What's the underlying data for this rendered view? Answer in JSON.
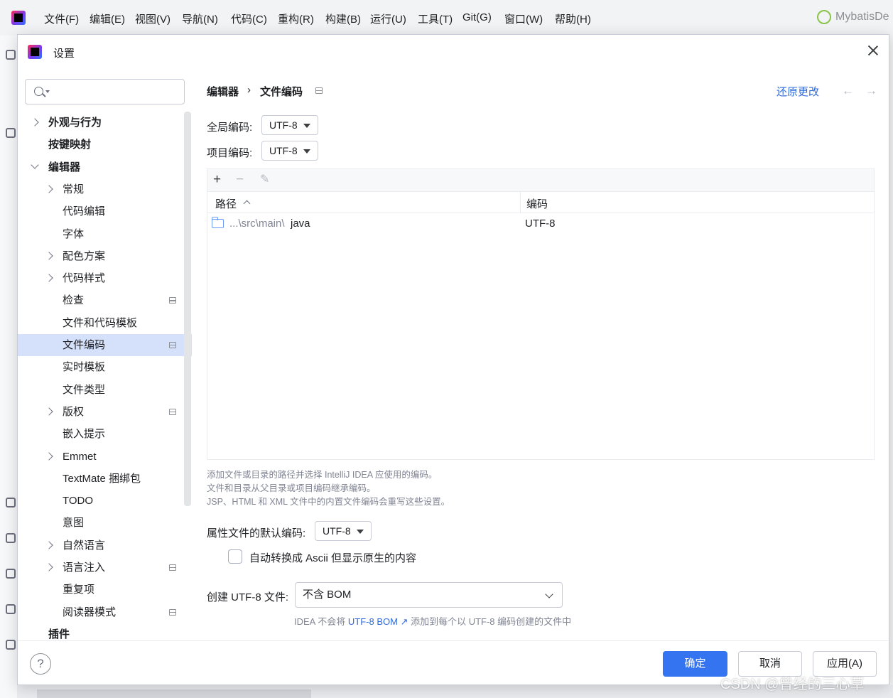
{
  "menubar": {
    "items": [
      "文件(F)",
      "编辑(E)",
      "视图(V)",
      "导航(N)",
      "代码(C)",
      "重构(R)",
      "构建(B)",
      "运行(U)",
      "工具(T)",
      "Git(G)",
      "窗口(W)",
      "帮助(H)"
    ],
    "project": "MybatisDe"
  },
  "dialog": {
    "title": "设置",
    "search": {
      "placeholder": ""
    },
    "tree": [
      {
        "label": "外观与行为",
        "level": 0,
        "bold": true,
        "chevron": "right",
        "scope": false,
        "selected": false
      },
      {
        "label": "按键映射",
        "level": 0,
        "bold": true,
        "chevron": "none",
        "scope": false,
        "selected": false
      },
      {
        "label": "编辑器",
        "level": 0,
        "bold": true,
        "chevron": "down",
        "scope": false,
        "selected": false
      },
      {
        "label": "常规",
        "level": 1,
        "bold": false,
        "chevron": "right",
        "scope": false,
        "selected": false
      },
      {
        "label": "代码编辑",
        "level": 1,
        "bold": false,
        "chevron": "none",
        "scope": false,
        "selected": false
      },
      {
        "label": "字体",
        "level": 1,
        "bold": false,
        "chevron": "none",
        "scope": false,
        "selected": false
      },
      {
        "label": "配色方案",
        "level": 1,
        "bold": false,
        "chevron": "right",
        "scope": false,
        "selected": false
      },
      {
        "label": "代码样式",
        "level": 1,
        "bold": false,
        "chevron": "right",
        "scope": false,
        "selected": false
      },
      {
        "label": "检查",
        "level": 1,
        "bold": false,
        "chevron": "none",
        "scope": true,
        "selected": false
      },
      {
        "label": "文件和代码模板",
        "level": 1,
        "bold": false,
        "chevron": "none",
        "scope": false,
        "selected": false
      },
      {
        "label": "文件编码",
        "level": 1,
        "bold": false,
        "chevron": "none",
        "scope": true,
        "selected": true
      },
      {
        "label": "实时模板",
        "level": 1,
        "bold": false,
        "chevron": "none",
        "scope": false,
        "selected": false
      },
      {
        "label": "文件类型",
        "level": 1,
        "bold": false,
        "chevron": "none",
        "scope": false,
        "selected": false
      },
      {
        "label": "版权",
        "level": 1,
        "bold": false,
        "chevron": "right",
        "scope": true,
        "selected": false
      },
      {
        "label": "嵌入提示",
        "level": 1,
        "bold": false,
        "chevron": "none",
        "scope": false,
        "selected": false
      },
      {
        "label": "Emmet",
        "level": 1,
        "bold": false,
        "chevron": "right",
        "scope": false,
        "selected": false
      },
      {
        "label": "TextMate 捆绑包",
        "level": 1,
        "bold": false,
        "chevron": "none",
        "scope": false,
        "selected": false
      },
      {
        "label": "TODO",
        "level": 1,
        "bold": false,
        "chevron": "none",
        "scope": false,
        "selected": false
      },
      {
        "label": "意图",
        "level": 1,
        "bold": false,
        "chevron": "none",
        "scope": false,
        "selected": false
      },
      {
        "label": "自然语言",
        "level": 1,
        "bold": false,
        "chevron": "right",
        "scope": false,
        "selected": false
      },
      {
        "label": "语言注入",
        "level": 1,
        "bold": false,
        "chevron": "right",
        "scope": true,
        "selected": false
      },
      {
        "label": "重复项",
        "level": 1,
        "bold": false,
        "chevron": "none",
        "scope": false,
        "selected": false
      },
      {
        "label": "阅读器模式",
        "level": 1,
        "bold": false,
        "chevron": "none",
        "scope": true,
        "selected": false
      },
      {
        "label": "插件",
        "level": 0,
        "bold": true,
        "chevron": "none",
        "scope": false,
        "selected": false
      }
    ],
    "breadcrumb": {
      "parent": "编辑器",
      "separator": "›",
      "current": "文件编码"
    },
    "reset_label": "还原更改",
    "global_encoding": {
      "label": "全局编码:",
      "value": "UTF-8"
    },
    "project_encoding": {
      "label": "项目编码:",
      "value": "UTF-8"
    },
    "table": {
      "toolbar": {
        "add": "+",
        "remove": "−",
        "edit": "✎"
      },
      "headers": {
        "path": "路径",
        "encoding": "编码"
      },
      "rows": [
        {
          "path_prefix": "...\\src\\main\\",
          "path_name": "java",
          "encoding": "UTF-8"
        }
      ]
    },
    "hints": [
      "添加文件或目录的路径并选择 IntelliJ IDEA 应使用的编码。",
      "文件和目录从父目录或项目编码继承编码。",
      "JSP、HTML 和 XML 文件中的内置文件编码会重写这些设置。"
    ],
    "properties_encoding": {
      "label": "属性文件的默认编码:",
      "value": "UTF-8"
    },
    "ascii_checkbox": {
      "label": "自动转换成 Ascii 但显示原生的内容",
      "checked": false
    },
    "bom": {
      "label": "创建 UTF-8 文件:",
      "value": "不含 BOM",
      "hint_prefix": "IDEA 不会将",
      "hint_link": "UTF-8 BOM",
      "hint_suffix": "添加到每个以 UTF-8 编码创建的文件中"
    },
    "buttons": {
      "ok": "确定",
      "cancel": "取消",
      "apply": "应用(A)"
    },
    "help": "?"
  },
  "watermark": "CSDN @曾经的三心草",
  "colors": {
    "accent": "#3574f0",
    "selection": "#d5e1fb",
    "link": "#2f6ad9"
  }
}
